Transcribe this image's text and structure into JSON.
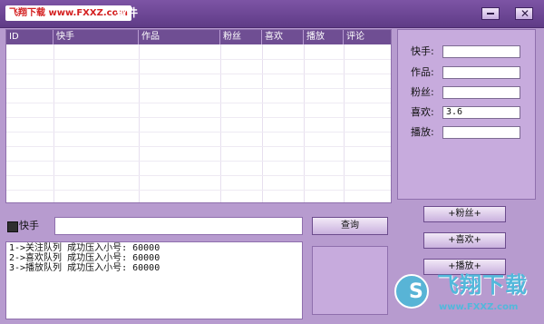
{
  "window": {
    "logo_text": "飞翔下载 www.FXXZ.com",
    "title_suffix": "软件"
  },
  "list": {
    "columns": [
      "ID",
      "快手",
      "作品",
      "粉丝",
      "喜欢",
      "播放",
      "评论"
    ]
  },
  "fields": [
    {
      "label": "快手:",
      "value": ""
    },
    {
      "label": "作品:",
      "value": ""
    },
    {
      "label": "粉丝:",
      "value": ""
    },
    {
      "label": "喜欢:",
      "value": "3.6"
    },
    {
      "label": "播放:",
      "value": ""
    }
  ],
  "search": {
    "checkbox_label": "快手",
    "button_label": "查询"
  },
  "actions": {
    "follow_label": "+粉丝+",
    "like_label": "+喜欢+",
    "play_label": "+播放+"
  },
  "log": [
    "1->关注队列 成功压入小号: 60000",
    "2->喜欢队列 成功压入小号: 60000",
    "3->播放队列 成功压入小号: 60000"
  ],
  "watermark": {
    "brand": "飞翔下载",
    "url": "www.FXXZ.com"
  }
}
